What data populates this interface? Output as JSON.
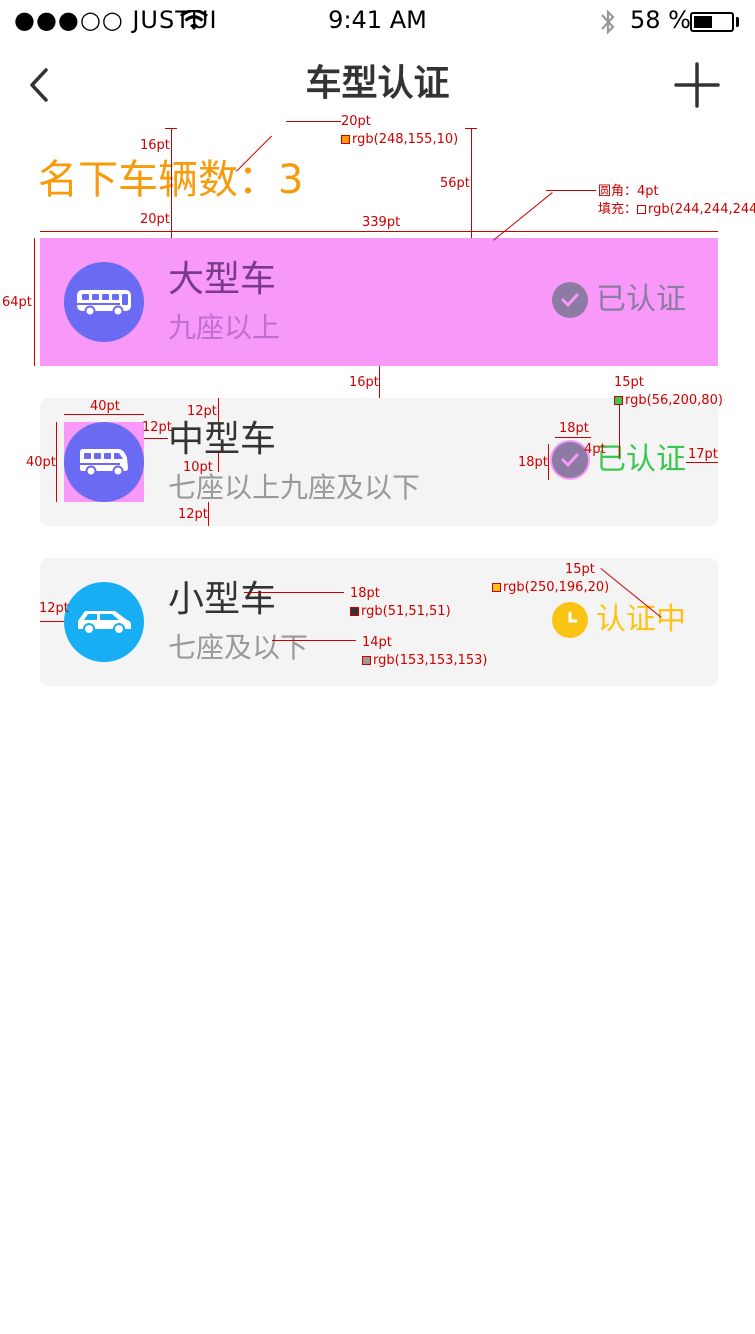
{
  "status_bar": {
    "carrier": "●●●○○ JUSTUI",
    "time": "9:41 AM",
    "battery_percent": "58 %"
  },
  "nav": {
    "title": "车型认证"
  },
  "summary": {
    "count_text": "名下车辆数：3"
  },
  "vehicles": [
    {
      "name": "大型车",
      "desc": "九座以上",
      "status": "已认证",
      "icon": "bus-icon",
      "avatar_color": "#6A6BF2",
      "status_color": "#8C7BA3"
    },
    {
      "name": "中型车",
      "desc": "七座以上九座及以下",
      "status": "已认证",
      "icon": "minibus-icon",
      "avatar_color": "#6A6BF2",
      "status_color": "#38C850"
    },
    {
      "name": "小型车",
      "desc": "七座及以下",
      "status": "认证中",
      "icon": "car-icon",
      "avatar_color": "#17AEF4",
      "status_color": "#FAC414"
    }
  ],
  "annotations": {
    "a1": "16pt",
    "a2": "20pt",
    "a3": "rgb(248,155,10)",
    "a4": "56pt",
    "a5": "圆角：4pt",
    "a6": "填充：",
    "a7": "rgb(244,244,244",
    "a8": "20pt",
    "a9": "339pt",
    "a10": "64pt",
    "a11": "16pt",
    "a12": "40pt",
    "a13": "12pt",
    "a14": "12pt",
    "a15": "15pt",
    "a16": "rgb(56,200,80)",
    "a17": "40pt",
    "a18": "18pt",
    "a19": "4pt",
    "a20": "18pt",
    "a21": "17pt",
    "a22": "10pt",
    "a23": "12pt",
    "a24": "15pt",
    "a25": "rgb(250,196,20)",
    "a26": "12pt",
    "a27": "18pt",
    "a28": "rgb(51,51,51)",
    "a29": "14pt",
    "a30": "rgb(153,153,153)"
  },
  "colors": {
    "orange": "#F89B0A",
    "card_bg": "#F4F4F4",
    "highlight": "#F898F8",
    "green": "#38C850",
    "yellow": "#FAC414",
    "text": "#333333",
    "sub": "#999999",
    "annotation": "#CC0000"
  }
}
